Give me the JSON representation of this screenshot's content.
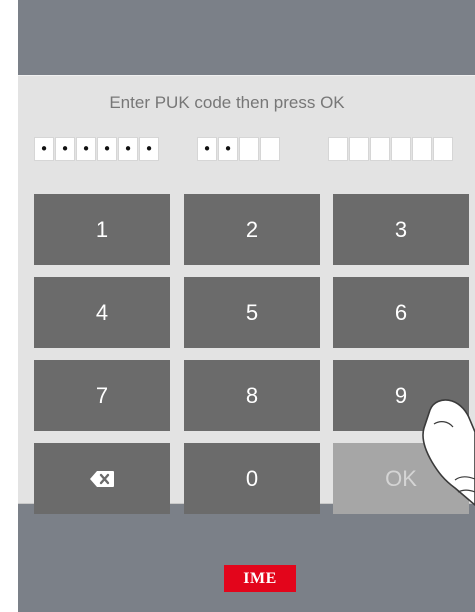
{
  "prompt": {
    "text": "Enter PUK code then press OK"
  },
  "code": {
    "groups": [
      {
        "digits": [
          "•",
          "•",
          "•",
          "•",
          "•",
          "•"
        ]
      },
      {
        "digits": [
          "•",
          "•",
          "",
          ""
        ]
      },
      {
        "digits": [
          "",
          "",
          "",
          "",
          "",
          ""
        ]
      }
    ]
  },
  "keypad": {
    "keys": [
      {
        "label": "1",
        "icon": ""
      },
      {
        "label": "2",
        "icon": ""
      },
      {
        "label": "3",
        "icon": ""
      },
      {
        "label": "4",
        "icon": ""
      },
      {
        "label": "5",
        "icon": ""
      },
      {
        "label": "6",
        "icon": ""
      },
      {
        "label": "7",
        "icon": ""
      },
      {
        "label": "8",
        "icon": ""
      },
      {
        "label": "9",
        "icon": ""
      },
      {
        "label": "",
        "icon": "backspace-icon"
      },
      {
        "label": "0",
        "icon": ""
      },
      {
        "label": "OK",
        "icon": ""
      }
    ]
  },
  "brand": {
    "label": "IME",
    "color": "#e3051b"
  },
  "colors": {
    "device_bezel": "#7b8088",
    "panel_background": "#e3e3e3",
    "key_background": "#6b6b6b",
    "ok_key_background": "#a6a6a6"
  }
}
